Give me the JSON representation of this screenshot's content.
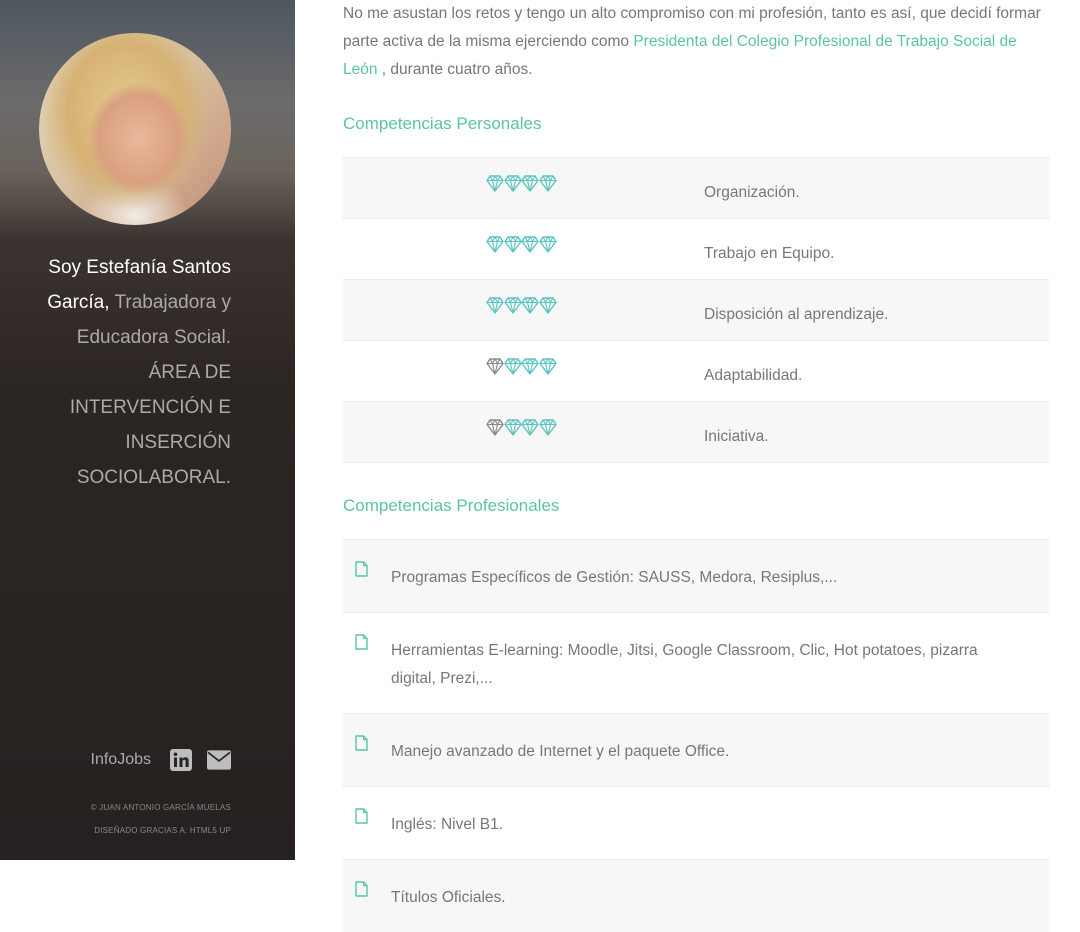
{
  "sidebar": {
    "intro_name": "Soy Estefanía Santos García,",
    "intro_rest": " Trabajadora y Educadora Social. ÁREA DE INTERVENCIÓN E INSERCIÓN SOCIOLABORAL.",
    "contact_infojobs": "InfoJobs",
    "icons": [
      "linkedin-icon",
      "envelope-icon"
    ],
    "copyright": "© Juan Antonio García Muelas",
    "credit": "Diseñado gracias a: HTML5 UP"
  },
  "main": {
    "lead_text": "No me asustan los retos y tengo un alto compromiso con mi profesión, tanto es así, que decidí formar parte activa de la misma ejerciendo como ",
    "lead_link": "Presidenta del Colegio Profesional de Trabajo Social de León",
    "lead_tail": " , durante cuatro años.",
    "personal_title": "Competencias Personales",
    "personal": [
      {
        "label": "Organización.",
        "rating": 4
      },
      {
        "label": "Trabajo en Equipo.",
        "rating": 4
      },
      {
        "label": "Disposición al aprendizaje.",
        "rating": 4
      },
      {
        "label": "Adaptabilidad.",
        "rating": 3
      },
      {
        "label": "Iniciativa.",
        "rating": 3
      }
    ],
    "rating_max": 4,
    "professional_title": "Competencias Profesionales",
    "professional": [
      "Programas Específicos de Gestión: SAUSS, Medora, Resiplus,...",
      "Herramientas E-learning: Moodle, Jitsi, Google Classroom, Clic, Hot potatoes, pizarra digital, Prezi,...",
      "Manejo avanzado de Internet y el paquete Office.",
      "Inglés: Nivel B1.",
      "Títulos Oficiales."
    ]
  },
  "colors": {
    "accent": "#5bc4a3",
    "gem_active": "#5bc4c0",
    "gem_inactive": "#8a8a8a"
  }
}
